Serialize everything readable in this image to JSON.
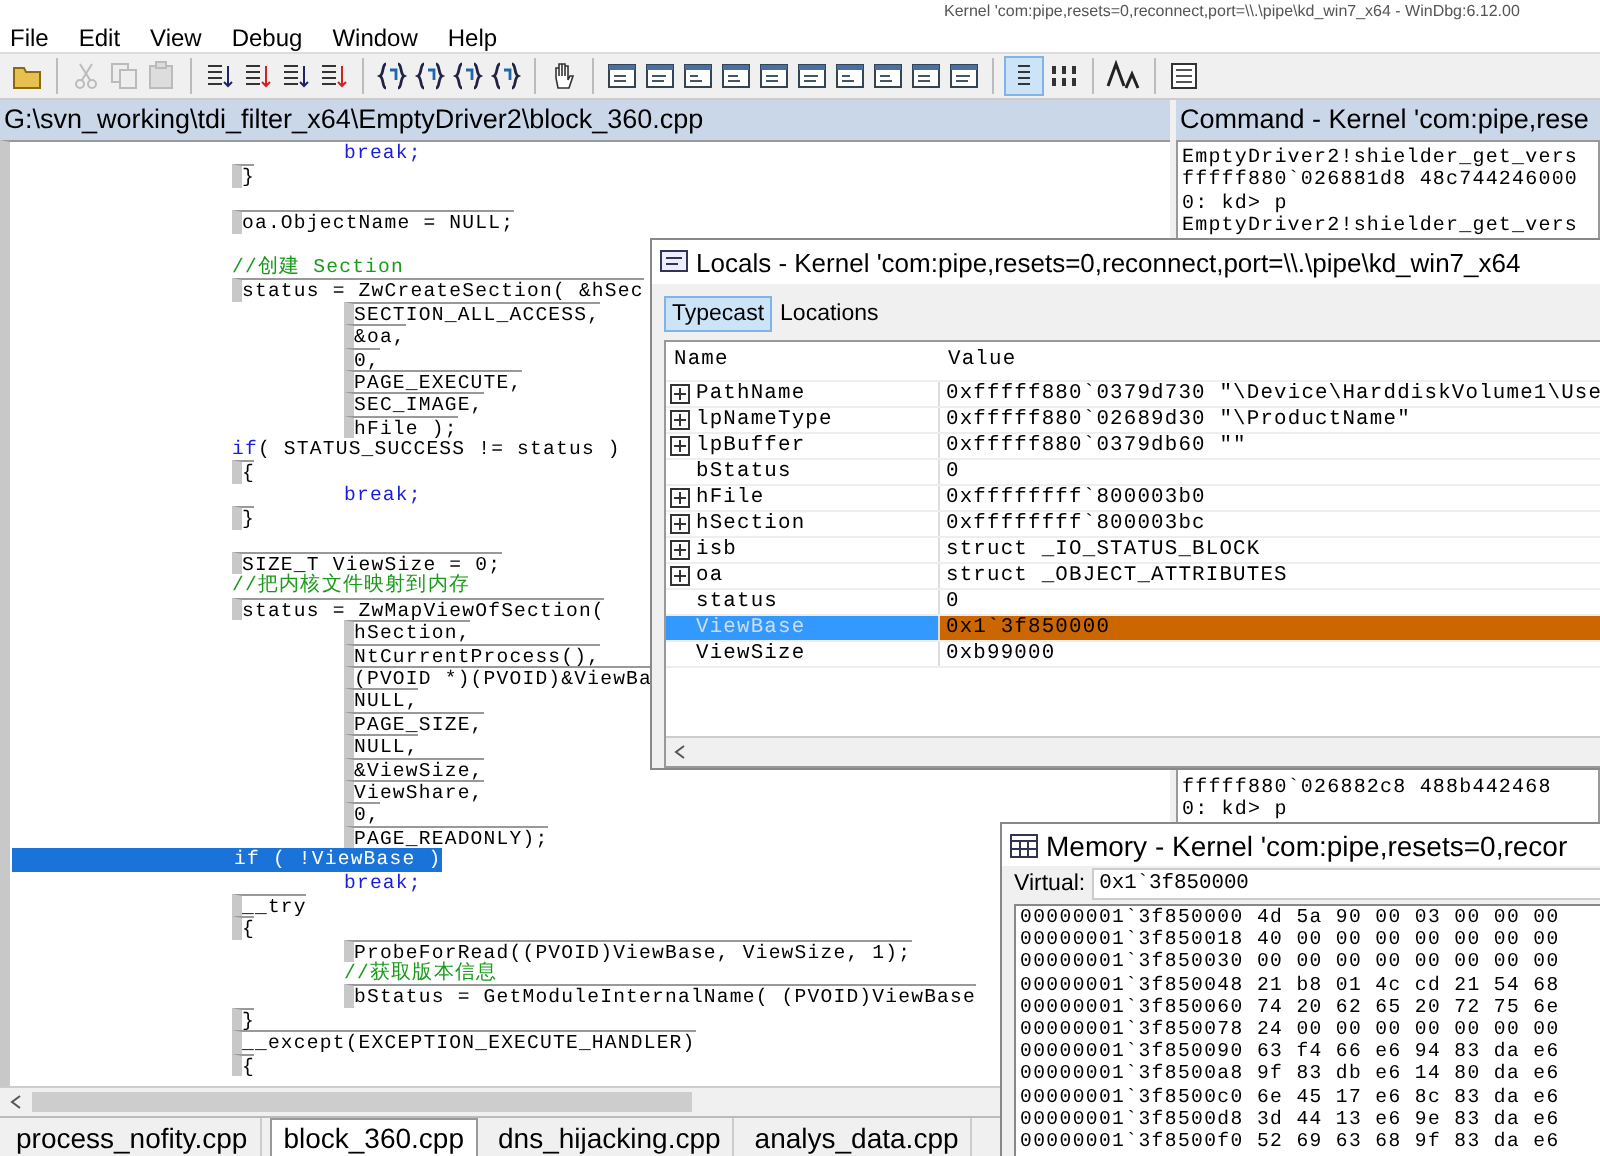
{
  "window": {
    "title": "Kernel 'com:pipe,resets=0,reconnect,port=\\\\.\\pipe\\kd_win7_x64 - WinDbg:6.12.00"
  },
  "menu": [
    "File",
    "Edit",
    "View",
    "Debug",
    "Window",
    "Help"
  ],
  "source": {
    "title": "G:\\svn_working\\tdi_filter_x64\\EmptyDriver2\\block_360.cpp",
    "lines": [
      {
        "kind": "keyword",
        "nested": true,
        "selected": false,
        "space_before": false,
        "text": "break;"
      },
      {
        "kind": "code",
        "nested": false,
        "selected": false,
        "space_before": false,
        "text": "}"
      },
      {
        "kind": "code",
        "nested": false,
        "selected": false,
        "space_before": true,
        "text": "oa.ObjectName = NULL;"
      },
      {
        "kind": "comment",
        "nested": false,
        "selected": false,
        "space_before": true,
        "text": "//创建 Section"
      },
      {
        "kind": "code",
        "nested": false,
        "selected": false,
        "space_before": false,
        "text": "status = ZwCreateSection( &hSec"
      },
      {
        "kind": "code",
        "nested": true,
        "selected": false,
        "space_before": false,
        "text": "SECTION_ALL_ACCESS,"
      },
      {
        "kind": "code",
        "nested": true,
        "selected": false,
        "space_before": false,
        "text": "&oa,"
      },
      {
        "kind": "code",
        "nested": true,
        "selected": false,
        "space_before": false,
        "text": "0,"
      },
      {
        "kind": "code",
        "nested": true,
        "selected": false,
        "space_before": false,
        "text": "PAGE_EXECUTE,"
      },
      {
        "kind": "code",
        "nested": true,
        "selected": false,
        "space_before": false,
        "text": "SEC_IMAGE,"
      },
      {
        "kind": "code",
        "nested": true,
        "selected": false,
        "space_before": false,
        "text": "hFile );"
      },
      {
        "kind": "if",
        "nested": false,
        "selected": false,
        "space_before": false,
        "keyword": "if",
        "text": "( STATUS_SUCCESS != status )"
      },
      {
        "kind": "code",
        "nested": false,
        "selected": false,
        "space_before": false,
        "text": "{"
      },
      {
        "kind": "keyword",
        "nested": true,
        "selected": false,
        "space_before": false,
        "text": "break;"
      },
      {
        "kind": "code",
        "nested": false,
        "selected": false,
        "space_before": false,
        "text": "}"
      },
      {
        "kind": "code",
        "nested": false,
        "selected": false,
        "space_before": true,
        "text": "SIZE_T ViewSize = 0;"
      },
      {
        "kind": "comment",
        "nested": false,
        "selected": false,
        "space_before": false,
        "text": "//把内核文件映射到内存"
      },
      {
        "kind": "code",
        "nested": false,
        "selected": false,
        "space_before": false,
        "text": "status = ZwMapViewOfSection("
      },
      {
        "kind": "code",
        "nested": true,
        "selected": false,
        "space_before": false,
        "text": "hSection,"
      },
      {
        "kind": "code",
        "nested": true,
        "selected": false,
        "space_before": false,
        "text": "NtCurrentProcess(),"
      },
      {
        "kind": "code",
        "nested": true,
        "selected": false,
        "space_before": false,
        "text": "(PVOID *)(PVOID)&ViewBa"
      },
      {
        "kind": "code",
        "nested": true,
        "selected": false,
        "space_before": false,
        "text": "NULL,"
      },
      {
        "kind": "code",
        "nested": true,
        "selected": false,
        "space_before": false,
        "text": "PAGE_SIZE,"
      },
      {
        "kind": "code",
        "nested": true,
        "selected": false,
        "space_before": false,
        "text": "NULL,"
      },
      {
        "kind": "code",
        "nested": true,
        "selected": false,
        "space_before": false,
        "text": "&ViewSize,"
      },
      {
        "kind": "code",
        "nested": true,
        "selected": false,
        "space_before": false,
        "text": "ViewShare,"
      },
      {
        "kind": "code",
        "nested": true,
        "selected": false,
        "space_before": false,
        "text": "0,"
      },
      {
        "kind": "code",
        "nested": true,
        "selected": false,
        "space_before": false,
        "text": "PAGE_READONLY);"
      },
      {
        "kind": "if",
        "nested": false,
        "selected": true,
        "space_before": false,
        "keyword": "if",
        "text": " ( !ViewBase )"
      },
      {
        "kind": "keyword",
        "nested": true,
        "selected": false,
        "space_before": false,
        "text": "break;"
      },
      {
        "kind": "code",
        "nested": false,
        "selected": false,
        "space_before": false,
        "text": "__try"
      },
      {
        "kind": "code",
        "nested": false,
        "selected": false,
        "space_before": false,
        "text": "{"
      },
      {
        "kind": "code",
        "nested": true,
        "selected": false,
        "space_before": false,
        "text": "ProbeForRead((PVOID)ViewBase, ViewSize, 1);"
      },
      {
        "kind": "comment",
        "nested": true,
        "selected": false,
        "space_before": false,
        "text": "//获取版本信息"
      },
      {
        "kind": "code",
        "nested": true,
        "selected": false,
        "space_before": false,
        "text": "bStatus = GetModuleInternalName( (PVOID)ViewBase"
      },
      {
        "kind": "code",
        "nested": false,
        "selected": false,
        "space_before": false,
        "text": "}"
      },
      {
        "kind": "code",
        "nested": false,
        "selected": false,
        "space_before": false,
        "text": "__except(EXCEPTION_EXECUTE_HANDLER)"
      },
      {
        "kind": "code",
        "nested": false,
        "selected": false,
        "space_before": false,
        "text": "{"
      }
    ],
    "tabs": [
      {
        "label": "process_nofity.cpp",
        "selected": false
      },
      {
        "label": "block_360.cpp",
        "selected": true
      },
      {
        "label": "dns_hijacking.cpp",
        "selected": false
      },
      {
        "label": "analys_data.cpp",
        "selected": false
      }
    ]
  },
  "command": {
    "title": "Command - Kernel 'com:pipe,rese",
    "lines_top": [
      "EmptyDriver2!shielder_get_vers",
      "fffff880`026881d8 48c744246000",
      "0: kd> p",
      "EmptyDriver2!shielder_get_vers"
    ],
    "lines_bottom": [
      "fffff880`026882c8 488b442468",
      "0: kd> p"
    ]
  },
  "locals": {
    "title": "Locals - Kernel 'com:pipe,resets=0,reconnect,port=\\\\.\\pipe\\kd_win7_x64",
    "tabs": [
      {
        "label": "Typecast",
        "selected": true
      },
      {
        "label": "Locations",
        "selected": false
      }
    ],
    "columns": [
      "Name",
      "Value"
    ],
    "rows": [
      {
        "name": "PathName",
        "value": "0xfffff880`0379d730 \"\\Device\\HarddiskVolume1\\Use",
        "expandable": true,
        "selected": false
      },
      {
        "name": "lpNameType",
        "value": "0xfffff880`02689d30 \"\\ProductName\"",
        "expandable": true,
        "selected": false
      },
      {
        "name": "lpBuffer",
        "value": "0xfffff880`0379db60 \"\"",
        "expandable": true,
        "selected": false
      },
      {
        "name": "bStatus",
        "value": "0",
        "expandable": false,
        "selected": false
      },
      {
        "name": "hFile",
        "value": "0xffffffff`800003b0",
        "expandable": true,
        "selected": false
      },
      {
        "name": "hSection",
        "value": "0xffffffff`800003bc",
        "expandable": true,
        "selected": false
      },
      {
        "name": "isb",
        "value": "struct _IO_STATUS_BLOCK",
        "expandable": true,
        "selected": false
      },
      {
        "name": "oa",
        "value": "struct _OBJECT_ATTRIBUTES",
        "expandable": true,
        "selected": false
      },
      {
        "name": "status",
        "value": "0",
        "expandable": false,
        "selected": false
      },
      {
        "name": "ViewBase",
        "value": "0x1`3f850000",
        "expandable": false,
        "selected": true
      },
      {
        "name": "ViewSize",
        "value": "0xb99000",
        "expandable": false,
        "selected": false
      }
    ]
  },
  "memory": {
    "title": "Memory - Kernel 'com:pipe,resets=0,recor",
    "address_label": "Virtual:",
    "address": "0x1`3f850000",
    "rows": [
      {
        "address": "00000001`3f850000",
        "bytes": "4d 5a 90 00 03 00 00 00"
      },
      {
        "address": "00000001`3f850018",
        "bytes": "40 00 00 00 00 00 00 00"
      },
      {
        "address": "00000001`3f850030",
        "bytes": "00 00 00 00 00 00 00 00"
      },
      {
        "address": "00000001`3f850048",
        "bytes": "21 b8 01 4c cd 21 54 68"
      },
      {
        "address": "00000001`3f850060",
        "bytes": "74 20 62 65 20 72 75 6e"
      },
      {
        "address": "00000001`3f850078",
        "bytes": "24 00 00 00 00 00 00 00"
      },
      {
        "address": "00000001`3f850090",
        "bytes": "63 f4 66 e6 94 83 da e6"
      },
      {
        "address": "00000001`3f8500a8",
        "bytes": "9f 83 db e6 14 80 da e6"
      },
      {
        "address": "00000001`3f8500c0",
        "bytes": "6e 45 17 e6 8c 83 da e6"
      },
      {
        "address": "00000001`3f8500d8",
        "bytes": "3d 44 13 e6 9e 83 da e6"
      },
      {
        "address": "00000001`3f8500f0",
        "bytes": "52 69 63 68 9f 83 da e6"
      }
    ]
  }
}
